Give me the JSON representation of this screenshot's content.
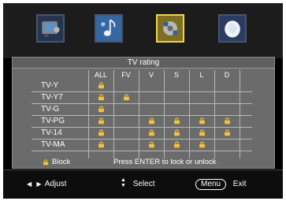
{
  "title": "TV rating",
  "columns": [
    "ALL",
    "FV",
    "V",
    "S",
    "L",
    "D"
  ],
  "rows": [
    {
      "label": "TV-Y",
      "locks": [
        true,
        false,
        false,
        false,
        false,
        false
      ]
    },
    {
      "label": "TV-Y7",
      "locks": [
        true,
        true,
        false,
        false,
        false,
        false
      ]
    },
    {
      "label": "TV-G",
      "locks": [
        true,
        false,
        false,
        false,
        false,
        false
      ]
    },
    {
      "label": "TV-PG",
      "locks": [
        true,
        false,
        true,
        true,
        true,
        true
      ]
    },
    {
      "label": "TV-14",
      "locks": [
        true,
        false,
        true,
        true,
        true,
        true
      ]
    },
    {
      "label": "TV-MA",
      "locks": [
        true,
        false,
        true,
        true,
        true,
        false
      ]
    }
  ],
  "legend": {
    "block_label": "Block",
    "hint": "Press ENTER to lock or unlock"
  },
  "footer": {
    "adjust_label": "Adjust",
    "select_label": "Select",
    "menu_label": "Menu",
    "exit_label": "Exit"
  },
  "icons": [
    "picture-icon",
    "audio-icon",
    "lock-settings-icon",
    "setup-icon"
  ],
  "colors": {
    "lock": "#f3c33a",
    "panel": "#6b6b6b",
    "selected_tile": "#f1d54a"
  }
}
